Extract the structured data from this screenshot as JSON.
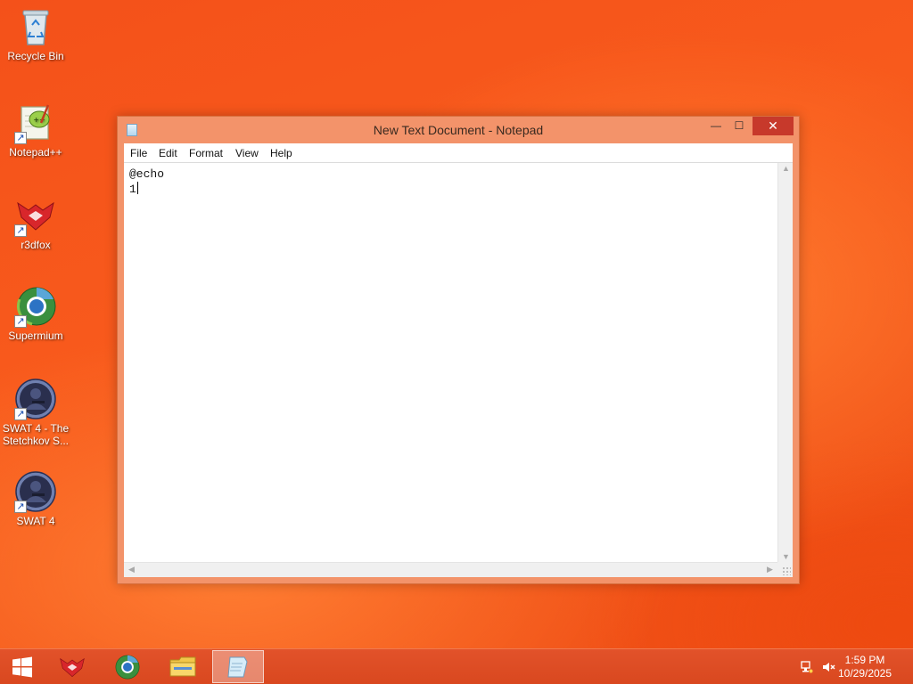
{
  "desktop": {
    "icons": [
      {
        "label": "Recycle Bin",
        "icon": "recycle-bin-icon"
      },
      {
        "label": "Notepad++",
        "icon": "notepad-plus-plus-icon"
      },
      {
        "label": "r3dfox",
        "icon": "r3dfox-icon"
      },
      {
        "label": "Supermium",
        "icon": "supermium-icon"
      },
      {
        "label": "SWAT 4 - The Stetchkov S...",
        "icon": "swat4-icon"
      },
      {
        "label": "SWAT 4",
        "icon": "swat4-icon"
      }
    ]
  },
  "window": {
    "title": "New Text Document - Notepad",
    "controls": {
      "minimize": "—",
      "maximize": "☐",
      "close": "✕"
    },
    "menu": [
      "File",
      "Edit",
      "Format",
      "View",
      "Help"
    ],
    "content_lines": [
      "@echo",
      "1"
    ]
  },
  "taskbar": {
    "start": "windows-logo-icon",
    "items": [
      {
        "icon": "r3dfox-icon",
        "active": false
      },
      {
        "icon": "supermium-icon",
        "active": false
      },
      {
        "icon": "file-explorer-icon",
        "active": false
      },
      {
        "icon": "notepad-icon",
        "active": true
      }
    ],
    "tray": {
      "network": "network-icon",
      "volume": "volume-muted-icon"
    },
    "time": "1:59 PM",
    "date": "10/29/2025"
  },
  "colors": {
    "desktop_background": "#f4511a",
    "window_frame": "#f3936a",
    "close_button": "#c7392b",
    "taskbar": "#dc4c22"
  }
}
